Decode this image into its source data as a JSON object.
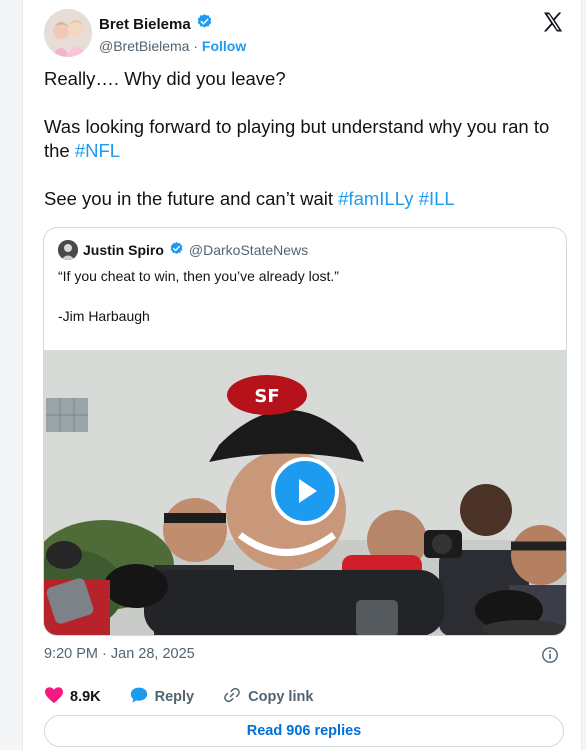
{
  "author": {
    "name": "Bret Bielema",
    "handle": "@BretBielema",
    "separator": "·",
    "follow_label": "Follow"
  },
  "tweet": {
    "paragraphs": [
      {
        "text": "Really…. Why did you leave?"
      },
      {
        "text_before": "Was looking forward to playing but understand why you ran to the ",
        "hashtag": "#NFL"
      },
      {
        "text_before": "See you in the future and can’t wait ",
        "hashtag_1": "#famILLy",
        "hashtag_2": "#ILL"
      }
    ]
  },
  "quote": {
    "name": "Justin Spiro",
    "handle": "@DarkoStateNews",
    "line1": "“If you cheat to win, then you’ve already lost.”",
    "line2": "-Jim Harbaugh",
    "media_type": "video"
  },
  "timestamp": "9:20 PM · Jan 28, 2025",
  "actions": {
    "likes": "8.9K",
    "reply_label": "Reply",
    "copy_label": "Copy link"
  },
  "read_replies_label": "Read 906 replies",
  "colors": {
    "accent": "#1d9bf0",
    "like": "#f91880",
    "muted": "#536471",
    "verified": "#1d9bf0"
  },
  "icons": [
    "x-logo-icon",
    "verified-badge-icon",
    "play-icon",
    "info-icon",
    "heart-icon",
    "reply-bubble-icon",
    "link-icon"
  ]
}
